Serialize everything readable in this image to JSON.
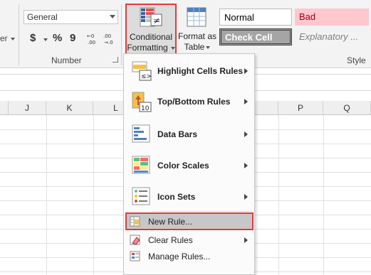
{
  "ribbon": {
    "number_format_value": "General",
    "currency_symbol": "$",
    "percent_symbol": "%",
    "comma_symbol": "9",
    "number_group_label": "Number",
    "conditional_formatting_line1": "Conditional",
    "conditional_formatting_line2": "Formatting",
    "format_as_table_line1": "Format as",
    "format_as_table_line2": "Table",
    "styles": {
      "normal": "Normal",
      "bad": "Bad",
      "check_cell": "Check Cell",
      "explanatory": "Explanatory ..."
    },
    "style_partial_label": "Style"
  },
  "sheet": {
    "columns": [
      "J",
      "K",
      "L",
      "P",
      "Q"
    ]
  },
  "menu": {
    "items": [
      {
        "label": "Highlight Cells Rules",
        "icon": "highlight-cells-icon",
        "has_submenu": true
      },
      {
        "label": "Top/Bottom Rules",
        "icon": "top-bottom-icon",
        "has_submenu": true
      },
      {
        "label": "Data Bars",
        "icon": "data-bars-icon",
        "has_submenu": true
      },
      {
        "label": "Color Scales",
        "icon": "color-scales-icon",
        "has_submenu": true
      },
      {
        "label": "Icon Sets",
        "icon": "icon-sets-icon",
        "has_submenu": true
      },
      {
        "label": "New Rule...",
        "icon": "new-rule-icon",
        "has_submenu": false
      },
      {
        "label": "Clear Rules",
        "icon": "clear-rules-icon",
        "has_submenu": true
      },
      {
        "label": "Manage Rules...",
        "icon": "manage-rules-icon",
        "has_submenu": false
      }
    ]
  },
  "colors": {
    "highlight_border": "#e23b3b",
    "bad_fill": "#ffc7ce",
    "bad_text": "#9c0006",
    "check_cell_fill": "#a5a5a5"
  }
}
